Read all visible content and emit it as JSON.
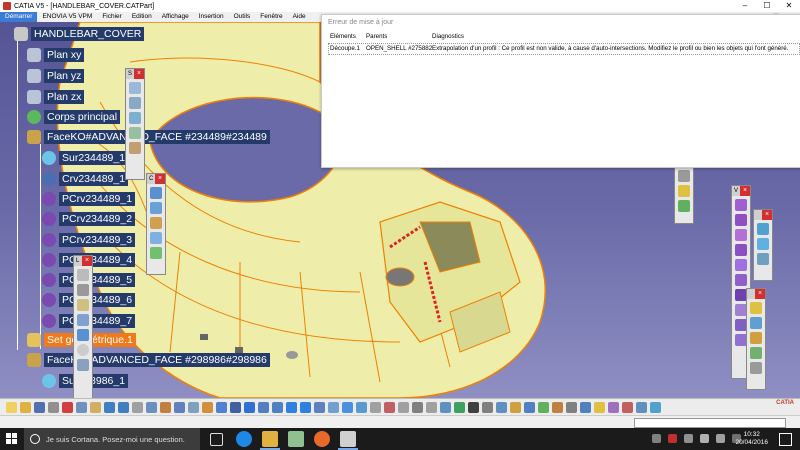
{
  "window": {
    "title": "CATIA V5 - [HANDLEBAR_COVER.CATPart]",
    "controls": [
      "–",
      "☐",
      "✕"
    ]
  },
  "menu": {
    "items": [
      "Démarrer",
      "ENOVIA V5 VPM",
      "Fichier",
      "Edition",
      "Affichage",
      "Insertion",
      "Outils",
      "Fenêtre",
      "Aide"
    ],
    "controls": [
      "–",
      "☐",
      "✕"
    ]
  },
  "tree": {
    "root": "HANDLEBAR_COVER",
    "plan_xy": "Plan xy",
    "plan_yz": "Plan yz",
    "plan_zx": "Plan zx",
    "body": "Corps principal",
    "face1": "FaceKO#ADVANCED_FACE #234489#234489",
    "sur1": "Sur234489_1",
    "crv1": "Crv234489_1",
    "pc1": "PCrv234489_1",
    "pc2": "PCrv234489_2",
    "pc3": "PCrv234489_3",
    "pc4": "PCrv234489_4",
    "pc5": "PCrv234489_5",
    "pc6": "PCrv234489_6",
    "pc7": "PCrv234489_7",
    "geoset": "Set géométrique.1",
    "face2": "FaceKO#ADVANCED_FACE #298986#298986",
    "sur2": "Sur298986_1"
  },
  "dialog": {
    "title": "Erreur de mise à jour",
    "headers": [
      "Eléments",
      "Parents",
      "Diagnostics"
    ],
    "row": [
      "Découpe.1",
      "OPEN_SHELL #275882",
      "Extrapolation d'un profil : Ce profil est non valide, à cause d'auto-intersections. Modifiez le profil ou bien les objets qui l'ont généré."
    ]
  },
  "toolbars": {
    "s_caption": "S",
    "c_caption": "C",
    "l_caption": "L",
    "v_caption": "V"
  },
  "taskbar": {
    "search_placeholder": "Je suis Cortana. Posez-moi une question.",
    "time": "10:32",
    "date": "20/04/2016"
  },
  "brand": {
    "catia": "CATIA"
  },
  "colors": {
    "tree_label_bg": "#233a6a",
    "selected_bg": "#f07a1a",
    "model_fill": "#f0f0a0",
    "model_edge": "#f08000",
    "error_edge": "#e02020"
  }
}
